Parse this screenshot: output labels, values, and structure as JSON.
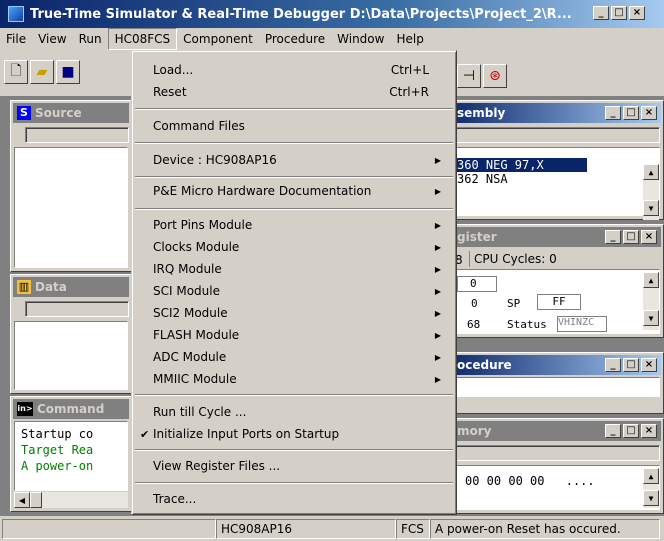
{
  "window": {
    "title": "True-Time Simulator & Real-Time Debugger   D:\\Data\\Projects\\Project_2\\R..."
  },
  "menubar": [
    "File",
    "View",
    "Run",
    "HC08FCS",
    "Component",
    "Procedure",
    "Window",
    "Help"
  ],
  "dropdown": {
    "items": [
      {
        "label": "Load...",
        "shortcut": "Ctrl+L"
      },
      {
        "label": "Reset",
        "shortcut": "Ctrl+R"
      },
      {
        "label": "Command Files"
      },
      {
        "label": "Device : HC908AP16"
      },
      {
        "label": "P&E Micro Hardware Documentation"
      },
      {
        "label": "Port Pins Module"
      },
      {
        "label": "Clocks Module"
      },
      {
        "label": "IRQ Module"
      },
      {
        "label": "SCI Module"
      },
      {
        "label": "SCI2 Module"
      },
      {
        "label": "FLASH Module"
      },
      {
        "label": "ADC Module"
      },
      {
        "label": "MMIIC Module"
      },
      {
        "label": "Run till Cycle ..."
      },
      {
        "label": "Initialize Input Ports on Startup",
        "checked": true
      },
      {
        "label": "View Register Files ..."
      },
      {
        "label": "Trace..."
      }
    ]
  },
  "panes": {
    "source": {
      "title": "Source"
    },
    "data": {
      "title": "Data"
    },
    "command": {
      "title": "Command",
      "lines": [
        "Startup co",
        "Target Rea",
        "A power-on"
      ]
    },
    "assembly": {
      "title": "sembly",
      "line1": "360 NEG    97,X",
      "line2": "362 NSA"
    },
    "register": {
      "title": "gister",
      "cycles_prefix": "8",
      "cycles": "CPU Cycles: 0",
      "r1": "0",
      "r2": "0",
      "sp_label": "SP",
      "sp_val": "FF",
      "r3": "68",
      "status_label": "Status",
      "status_val": "VHINZC"
    },
    "procedure": {
      "title": "ocedure"
    },
    "memory": {
      "title": "mory",
      "row": "00 00 00 00",
      "ascii": "...."
    }
  },
  "statusbar": {
    "device": "HC908AP16",
    "mode": "FCS",
    "message": "A power-on Reset has occured."
  }
}
